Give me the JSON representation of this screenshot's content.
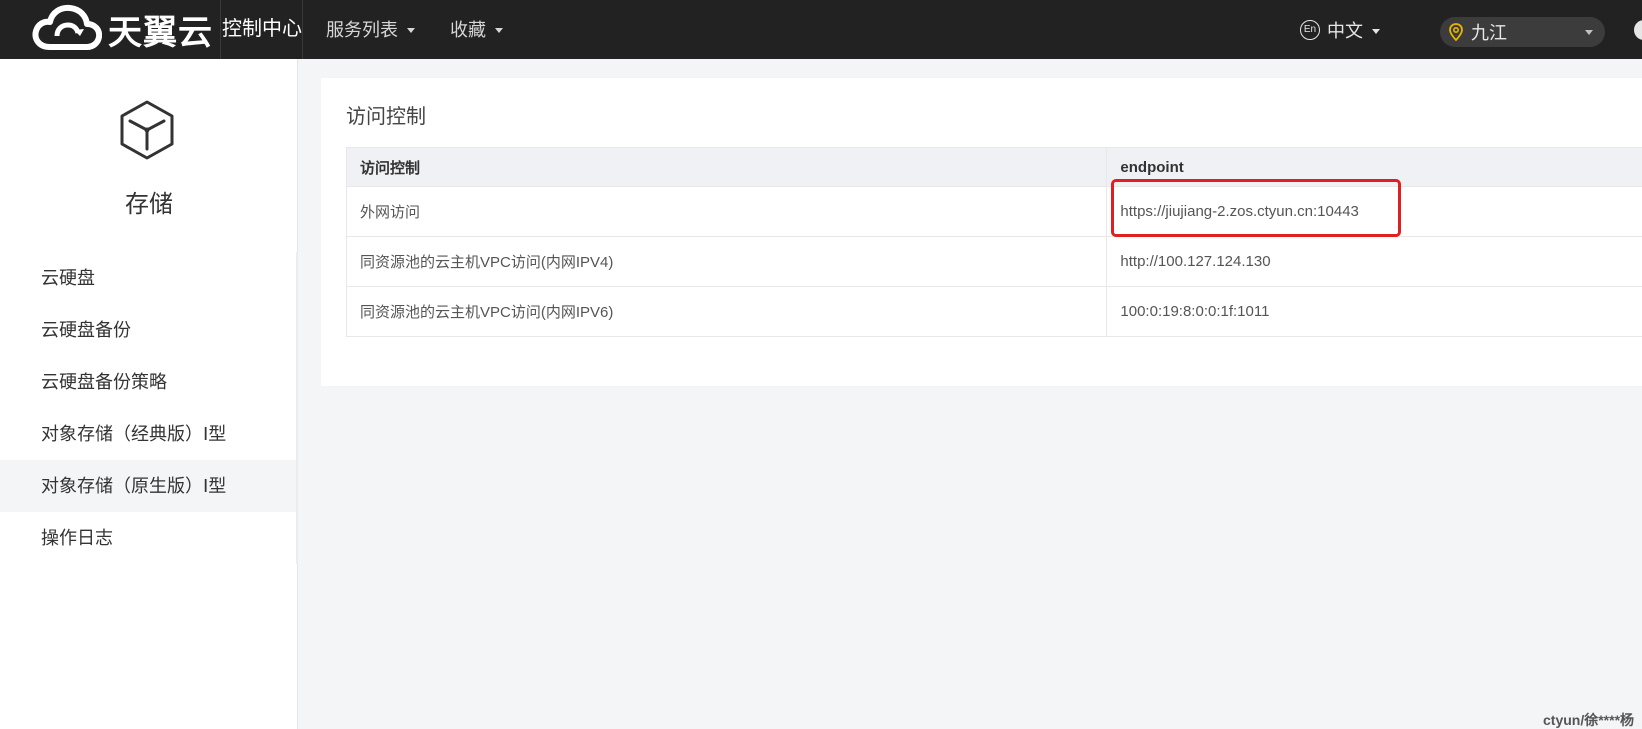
{
  "header": {
    "brand": "天翼云",
    "console_title": "控制中心",
    "nav": [
      "服务列表",
      "收藏"
    ],
    "lang_icon": "En",
    "lang": "中文",
    "region": "九江"
  },
  "sidebar": {
    "title": "存储",
    "items": [
      {
        "label": "云硬盘",
        "active": false
      },
      {
        "label": "云硬盘备份",
        "active": false
      },
      {
        "label": "云硬盘备份策略",
        "active": false
      },
      {
        "label": "对象存储（经典版）Ⅰ型",
        "active": false
      },
      {
        "label": "对象存储（原生版）Ⅰ型",
        "active": true
      },
      {
        "label": "操作日志",
        "active": false
      }
    ]
  },
  "main": {
    "title": "访问控制",
    "table": {
      "columns": [
        "访问控制",
        "endpoint"
      ],
      "rows": [
        [
          "外网访问",
          "https://jiujiang-2.zos.ctyun.cn:10443"
        ],
        [
          "同资源池的云主机VPC访问(内网IPV4)",
          "http://100.127.124.130"
        ],
        [
          "同资源池的云主机VPC访问(内网IPV6)",
          "100:0:19:8:0:0:1f:1011"
        ]
      ]
    }
  },
  "watermark": "ctyun/徐****杨",
  "colors": {
    "topbar": "#222222",
    "highlight": "#e02020",
    "panel": "#ffffff",
    "background": "#f4f5f7"
  }
}
